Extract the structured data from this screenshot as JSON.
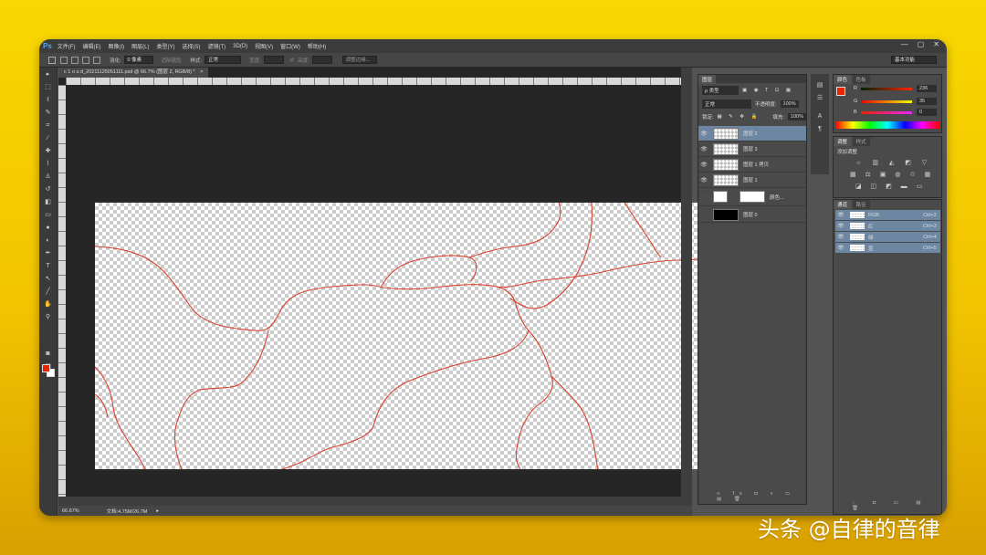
{
  "menubar": {
    "logo": "Ps",
    "items": [
      "文件(F)",
      "编辑(E)",
      "图像(I)",
      "图层(L)",
      "类型(Y)",
      "选择(S)",
      "滤镜(T)",
      "3D(D)",
      "视图(V)",
      "窗口(W)",
      "帮助(H)"
    ],
    "window_controls": [
      "—",
      "▢",
      "✕"
    ]
  },
  "options": {
    "feather_label": "羽化:",
    "feather_value": "0 像素",
    "antialias_label": "消除锯齿",
    "style_label": "样式:",
    "style_value": "正常",
    "width_label": "宽度:",
    "height_label": "高度:",
    "refine_edge": "调整边缘...",
    "workspace": "基本功能"
  },
  "document": {
    "tab_title": "c 1 o u d_20211125051111.psd @ 66.7% (图层 2, RGB/8) *",
    "tab_close": "×",
    "ruler_labels": [
      "0",
      "2",
      "4",
      "6",
      "8",
      "10",
      "12",
      "14",
      "16",
      "18",
      "20",
      "22",
      "24",
      "26",
      "28",
      "30",
      "32",
      "34",
      "36",
      "38",
      "40"
    ]
  },
  "status": {
    "zoom": "66.67%",
    "doc_info": "文档:4.75M/26.7M"
  },
  "layers_panel": {
    "tab": "图层",
    "filter_label": "ρ 类型",
    "blend_mode": "正常",
    "opacity_label": "不透明度:",
    "opacity_value": "100%",
    "lock_label": "锁定:",
    "fill_label": "填充:",
    "fill_value": "100%",
    "layers": [
      {
        "name": "图层 2",
        "visible": true,
        "selected": true
      },
      {
        "name": "图层 3",
        "visible": true,
        "selected": false
      },
      {
        "name": "图层 1 拷贝",
        "visible": true,
        "selected": false
      },
      {
        "name": "图层 1",
        "visible": true,
        "selected": false
      },
      {
        "name": "颜色...",
        "visible": false,
        "selected": false
      },
      {
        "name": "图层 0",
        "visible": false,
        "selected": false
      }
    ]
  },
  "color_panel": {
    "tabs": [
      "颜色",
      "色板"
    ],
    "r_label": "R",
    "r_value": "236",
    "g_label": "G",
    "g_value": "35",
    "b_label": "B",
    "b_value": "0",
    "foreground": "#ec2300",
    "background": "#ffffff"
  },
  "adjust_panel": {
    "tabs": [
      "调整",
      "样式"
    ],
    "title": "添加调整"
  },
  "channels_panel": {
    "tabs": [
      "通道",
      "路径"
    ],
    "channels": [
      {
        "name": "RGB",
        "shortcut": "Ctrl+2"
      },
      {
        "name": "红",
        "shortcut": "Ctrl+3"
      },
      {
        "name": "绿",
        "shortcut": "Ctrl+4"
      },
      {
        "name": "蓝",
        "shortcut": "Ctrl+5"
      }
    ]
  },
  "watermark": "头条 @自律的音律",
  "colors": {
    "crack": "#d8402e",
    "selection": "#6d87a3"
  }
}
